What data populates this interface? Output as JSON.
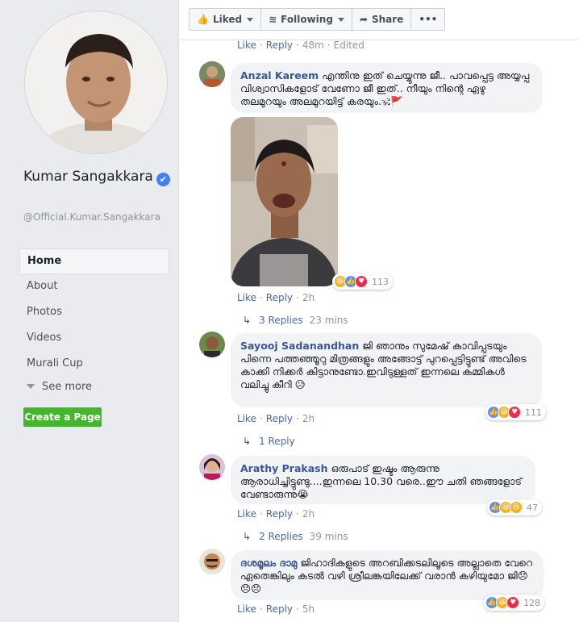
{
  "profile": {
    "name": "Kumar Sangakkara",
    "handle": "@Official.Kumar.Sangakkara",
    "verified_symbol": "✔"
  },
  "nav": {
    "items": [
      "Home",
      "About",
      "Photos",
      "Videos",
      "Murali Cup"
    ],
    "see_more": "See more",
    "create_page": "Create a Page"
  },
  "actions": {
    "liked": "Liked",
    "following": "Following",
    "share": "Share",
    "more": "•••"
  },
  "top_links": {
    "like": "Like",
    "reply": "Reply",
    "time": "48m",
    "edited": "Edited"
  },
  "comments": [
    {
      "author": "Anzal Kareem",
      "text": "എന്തിനു ഇത് ചെയ്യുന്നു ജീ.. പാവപ്പെട്ട അയ്യപ്പ വിശ്വാസികളോട് വേണോ ജീ ഇത്.. നീയും നിന്റെ ഏഴു തലമുറയും അലമുറയിട്ട് കരയും.🕉🚩",
      "reaction_count": "113",
      "like": "Like",
      "reply": "Reply",
      "time": "2h",
      "replies": "3 Replies",
      "replies_time": "23 mins"
    },
    {
      "author": "Sayooj Sadanandhan",
      "text": "ജി ഞാനും സുമേഷ് കാവിപ്പടയും പിന്നെ പത്തഞ്ഞൂറു മിത്രങ്ങളും അങ്ങോട്ട് പുറപ്പെട്ടിട്ടുണ്ട് അവിടെ കാക്കി നിക്കർ കിട്ടാനുണ്ടോ.ഇവിടുള്ളത് ഇന്നലെ കമ്മികൾ വലിച്ചു കീറി 😥",
      "reaction_count": "111",
      "like": "Like",
      "reply": "Reply",
      "time": "2h",
      "replies": "1 Reply",
      "replies_time": ""
    },
    {
      "author": "Arathy Prakash",
      "text": "ഒരുപാട് ഇഷ്ടം ആരുന്നു ആരാധിച്ചിട്ടുണ്ടു....ഇന്നലെ 10.30 വരെ..ഈ ചതി ഞങ്ങളോട് വേണ്ടാരുന്നു😭",
      "reaction_count": "47",
      "like": "Like",
      "reply": "Reply",
      "time": "2h",
      "replies": "2 Replies",
      "replies_time": "39 mins"
    },
    {
      "author": "ദശമൂലം ദാമു",
      "text": "ജിഹാദികളുടെ അറബിക്കടലിലൂടെ അല്ലാതെ വേറെ ഏതെങ്കിലും കടൽ വഴി ശ്രീലങ്കയിലേക്ക് വരാൻ കഴിയുമോ ജി😞😞😞",
      "reaction_count": "128",
      "like": "Like",
      "reply": "Reply",
      "time": "5h"
    }
  ],
  "icons": {
    "like": "thumbs-up-icon",
    "share": "share-arrow-icon",
    "reply_arrow": "reply-arrow-icon"
  },
  "colors": {
    "link": "#385898",
    "green_button": "#42b72a",
    "like_reaction": "#5890ff",
    "love_reaction": "#f0284a"
  }
}
